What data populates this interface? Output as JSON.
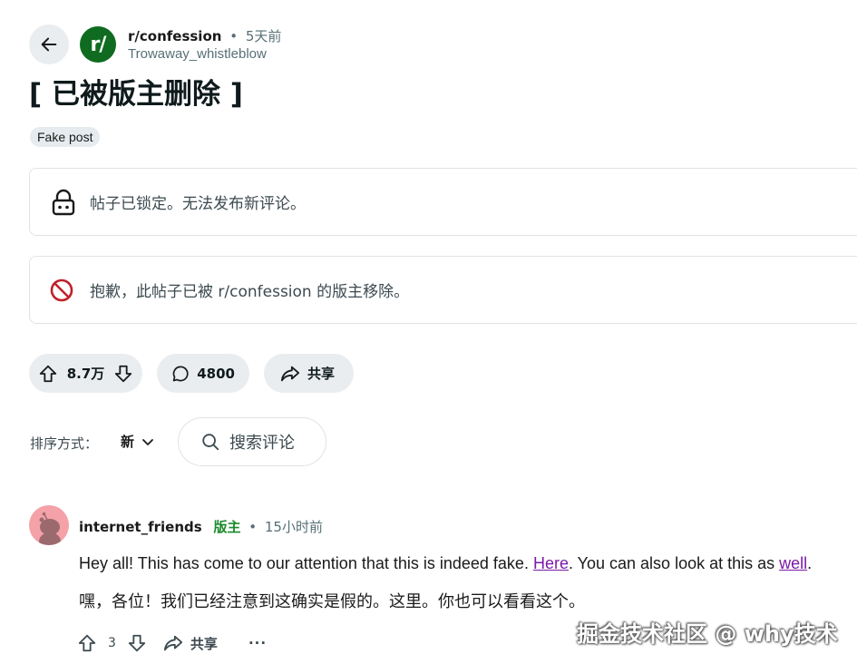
{
  "header": {
    "subreddit": "r/confession",
    "separator": "•",
    "time": "5天前",
    "author": "Trowaway_whistleblow",
    "avatar_text": "r/",
    "avatar_color": "#0f6b1f"
  },
  "post": {
    "title": "[ 已被版主删除 ]",
    "flair": "Fake post",
    "locked_notice": "帖子已锁定。无法发布新评论。",
    "removed_notice": "抱歉，此帖子已被 r/confession 的版主移除。"
  },
  "actions": {
    "votes": "8.7万",
    "comments": "4800",
    "share": "共享"
  },
  "sort": {
    "label": "排序方式：",
    "value": "新",
    "search_placeholder": "搜索评论"
  },
  "comment": {
    "user": "internet_friends",
    "mod_badge": "版主",
    "separator": "•",
    "time": "15小时前",
    "body_en_1": "Hey all! This has come to our attention that this is indeed fake. ",
    "link_1": "Here",
    "body_en_2": ". You can also look at this as ",
    "link_2": "well",
    "body_en_3": ".",
    "body_zh": "嘿，各位！我们已经注意到这确实是假的。这里。你也可以看看这个。",
    "votes": "3",
    "share": "共享",
    "more": "···"
  },
  "watermark": "掘金技术社区 @ why技术"
}
